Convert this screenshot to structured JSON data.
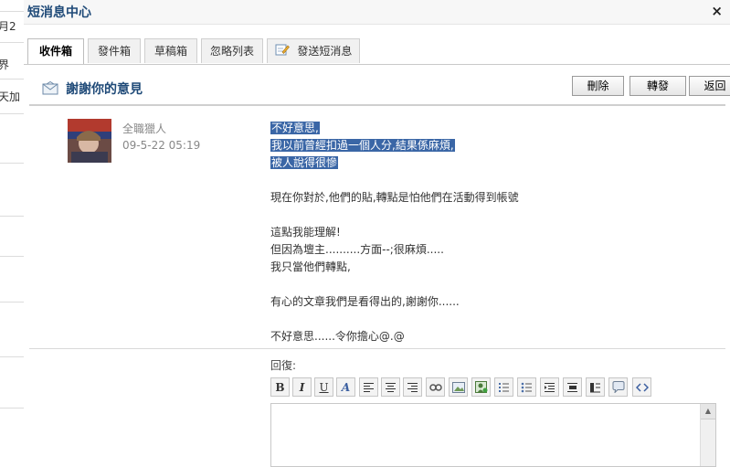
{
  "background": {
    "fragments": [
      "月2",
      "界",
      "天加"
    ]
  },
  "dialog": {
    "title": "短消息中心",
    "close_glyph": "×"
  },
  "tabs": [
    {
      "label": "收件箱"
    },
    {
      "label": "發件箱"
    },
    {
      "label": "草稿箱"
    },
    {
      "label": "忽略列表"
    },
    {
      "label": "發送短消息"
    }
  ],
  "message_header": {
    "subject": "謝謝你的意見",
    "buttons": {
      "delete": "刪除",
      "forward": "轉發",
      "back": "返回"
    }
  },
  "message": {
    "sender": "全職獵人",
    "time": "09-5-22 05:19",
    "lines": [
      "不好意思,",
      "我以前曾經扣過一個人分,結果係麻煩,",
      "被人說得很慘",
      "",
      "現在你對於,他們的貼,轉點是怕他們在活動得到帳號",
      "",
      "這點我能理解!",
      "但因為壇主..........方面--;很麻煩.....",
      "我只當他們轉點,",
      "",
      "有心的文章我們是看得出的,謝謝你......",
      "",
      "不好意思......令你擔心@.@"
    ]
  },
  "reply": {
    "label": "回復:",
    "toolbar": [
      "B",
      "I",
      "U",
      "A"
    ]
  },
  "colors": {
    "title": "#1f4a78",
    "highlight": "#3a66a6"
  }
}
